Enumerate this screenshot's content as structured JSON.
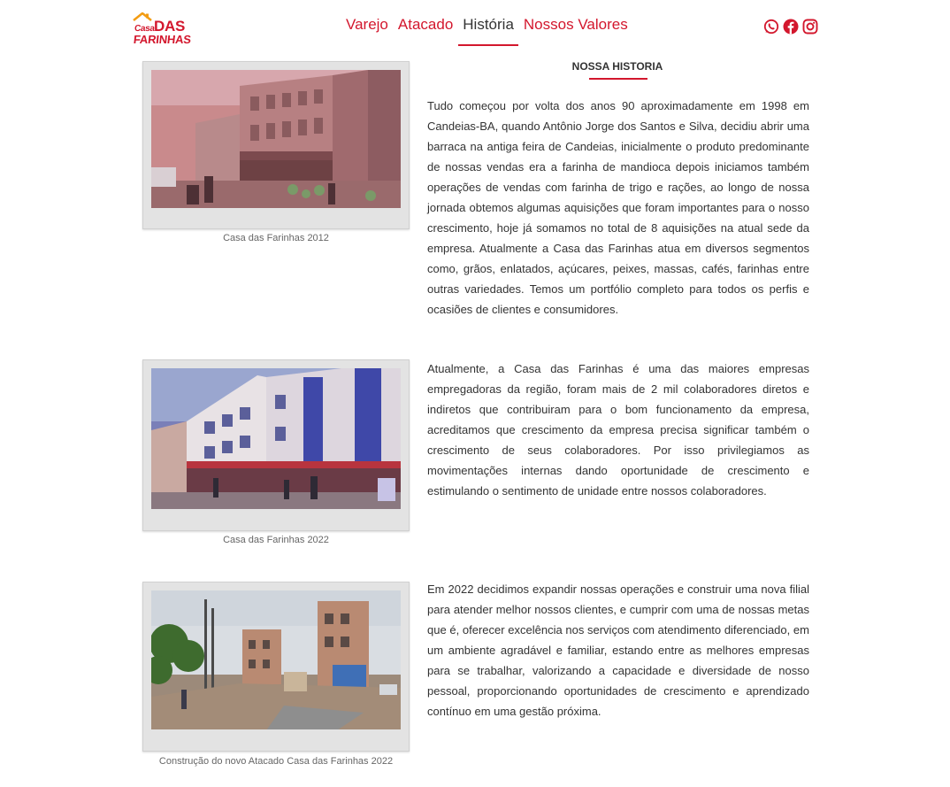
{
  "brand": {
    "logo_top": "Casa",
    "logo_das": "DAS",
    "logo_bottom": "FARINHAS",
    "color": "#d3172d"
  },
  "nav": {
    "items": [
      {
        "label": "Varejo",
        "active": false
      },
      {
        "label": "Atacado",
        "active": false
      },
      {
        "label": "História",
        "active": true
      },
      {
        "label": "Nossos Valores",
        "active": false
      }
    ]
  },
  "social": {
    "icons": [
      "whatsapp-icon",
      "facebook-icon",
      "instagram-icon"
    ]
  },
  "section": {
    "title": "NOSSA HISTORIA"
  },
  "entries": [
    {
      "caption": "Casa das Farinhas 2012",
      "text": "Tudo começou por volta dos anos 90 aproximadamente em 1998 em Candeias-BA, quando Antônio Jorge dos Santos e Silva, decidiu abrir uma barraca na antiga feira de Candeias, inicialmente o produto predominante de nossas vendas era a farinha de mandioca depois iniciamos também operações de vendas com farinha de trigo e rações, ao longo de nossa jornada obtemos algumas aquisições que foram importantes para o nosso crescimento, hoje já somamos no total de 8 aquisições na atual sede da empresa. Atualmente a Casa das Farinhas atua em diversos segmentos como, grãos, enlatados, açúcares, peixes, massas, cafés, farinhas entre outras variedades. Temos um portfólio completo para todos os perfis e ocasiões de clientes e consumidores."
    },
    {
      "caption": "Casa das Farinhas 2022",
      "text": "Atualmente, a Casa das Farinhas é uma das maiores empresas empregadoras da região, foram mais de 2 mil colaboradores diretos e indiretos que contribuiram para o bom funcionamento da empresa, acreditamos que crescimento da empresa precisa significar também o crescimento de seus colaboradores. Por isso privilegiamos as movimentações internas dando oportunidade de crescimento e estimulando o sentimento de unidade entre nossos colaboradores."
    },
    {
      "caption": "Construção do novo Atacado Casa das Farinhas 2022",
      "text": "Em 2022 decidimos expandir nossas operações e construir uma nova filial para atender melhor nossos clientes, e cumprir com uma de nossas metas que é, oferecer excelência nos serviços com atendimento diferenciado, em um ambiente agradável e familiar, estando entre as melhores empresas para se trabalhar, valorizando a capacidade e diversidade de nosso pessoal, proporcionando oportunidades de crescimento e aprendizado contínuo em uma gestão próxima."
    }
  ]
}
